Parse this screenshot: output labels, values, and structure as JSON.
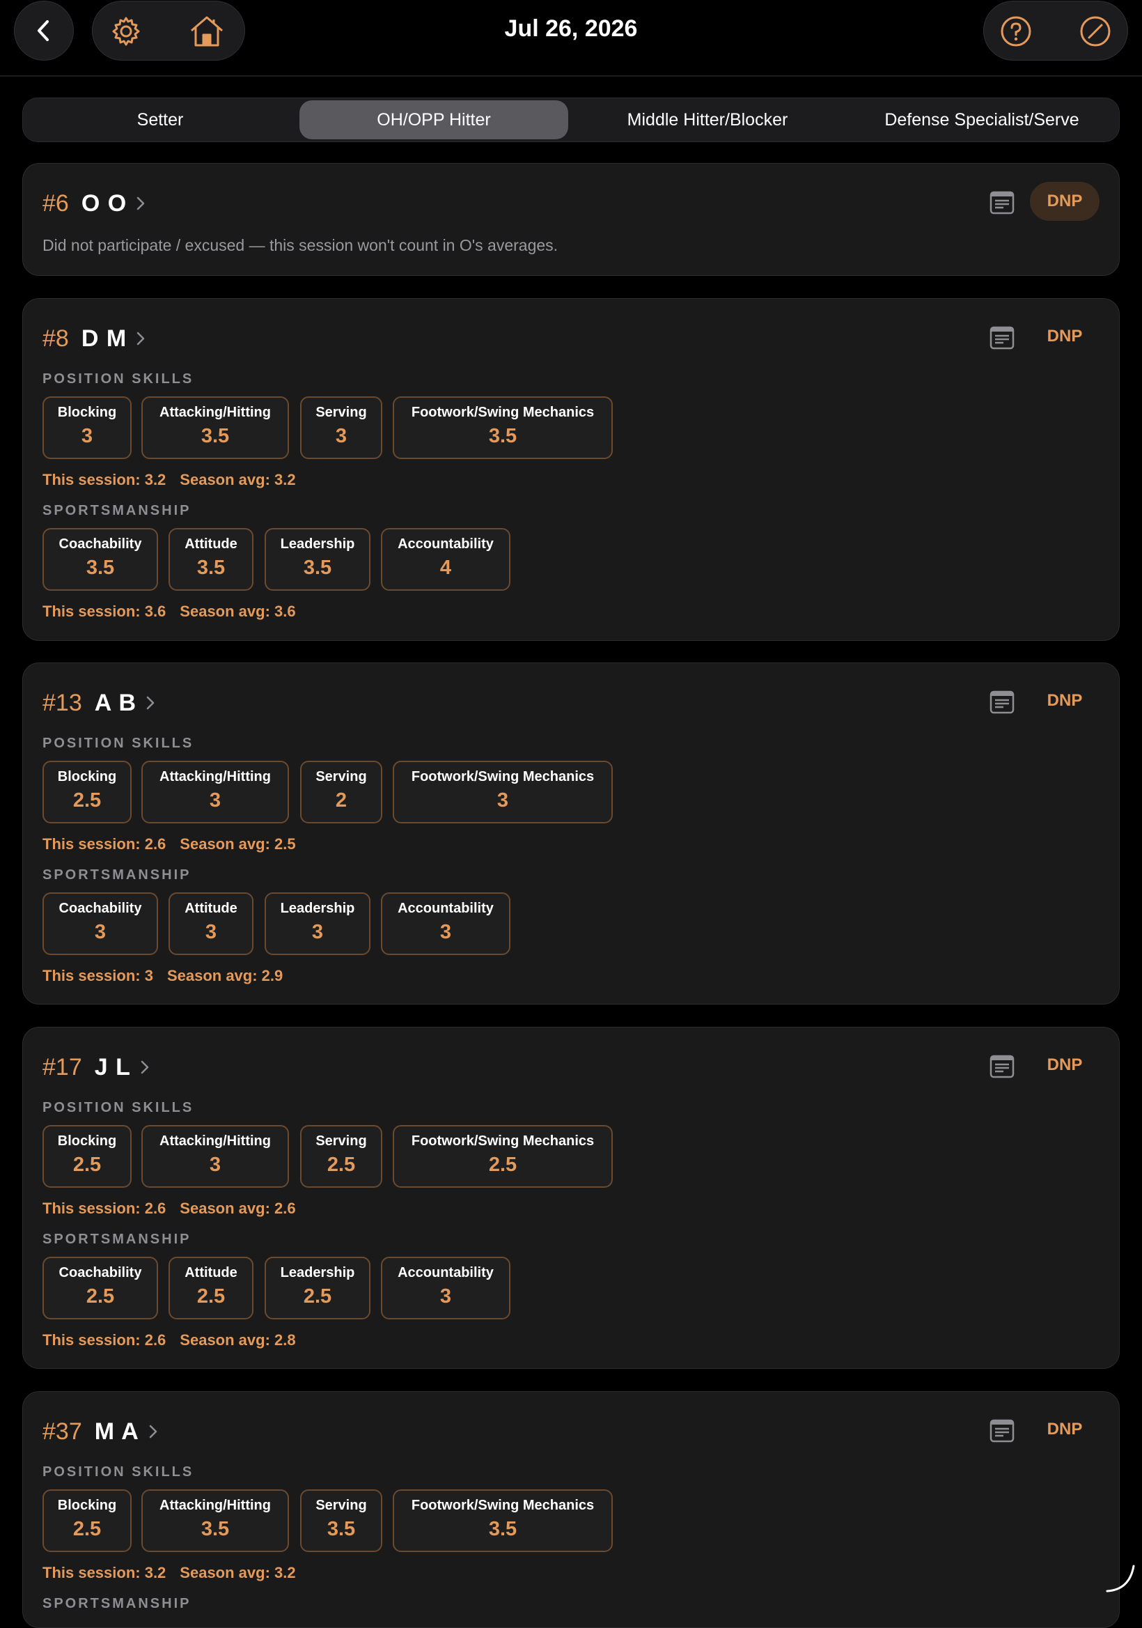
{
  "header": {
    "date": "Jul 26, 2026",
    "icons": [
      "back-chevron-icon",
      "gear-icon",
      "home-icon",
      "help-icon",
      "compass-icon"
    ],
    "accent": "#e39a5a"
  },
  "tabs": [
    {
      "label": "Setter",
      "active": false
    },
    {
      "label": "OH/OPP Hitter",
      "active": true
    },
    {
      "label": "Middle Hitter/Blocker",
      "active": false
    },
    {
      "label": "Defense Specialist/Serve",
      "active": false
    }
  ],
  "section_labels": {
    "position": "POSITION SKILLS",
    "sportsmanship": "SPORTSMANSHIP"
  },
  "dnp_label": "DNP",
  "players": [
    {
      "number": "#6",
      "name": "O O",
      "dnp": true,
      "dnp_message": "Did not participate / excused — this session won't count in O's averages."
    },
    {
      "number": "#8",
      "name": "D M",
      "dnp": false,
      "position_skills": [
        {
          "label": "Blocking",
          "value": "3"
        },
        {
          "label": "Attacking/Hitting",
          "value": "3.5"
        },
        {
          "label": "Serving",
          "value": "3"
        },
        {
          "label": "Footwork/Swing Mechanics",
          "value": "3.5"
        }
      ],
      "position_session": "This session: 3.2",
      "position_season": "Season avg: 3.2",
      "sportsmanship": [
        {
          "label": "Coachability",
          "value": "3.5"
        },
        {
          "label": "Attitude",
          "value": "3.5"
        },
        {
          "label": "Leadership",
          "value": "3.5"
        },
        {
          "label": "Accountability",
          "value": "4"
        }
      ],
      "sport_session": "This session: 3.6",
      "sport_season": "Season avg: 3.6"
    },
    {
      "number": "#13",
      "name": "A B",
      "dnp": false,
      "position_skills": [
        {
          "label": "Blocking",
          "value": "2.5"
        },
        {
          "label": "Attacking/Hitting",
          "value": "3"
        },
        {
          "label": "Serving",
          "value": "2"
        },
        {
          "label": "Footwork/Swing Mechanics",
          "value": "3"
        }
      ],
      "position_session": "This session: 2.6",
      "position_season": "Season avg: 2.5",
      "sportsmanship": [
        {
          "label": "Coachability",
          "value": "3"
        },
        {
          "label": "Attitude",
          "value": "3"
        },
        {
          "label": "Leadership",
          "value": "3"
        },
        {
          "label": "Accountability",
          "value": "3"
        }
      ],
      "sport_session": "This session: 3",
      "sport_season": "Season avg: 2.9"
    },
    {
      "number": "#17",
      "name": "J L",
      "dnp": false,
      "position_skills": [
        {
          "label": "Blocking",
          "value": "2.5"
        },
        {
          "label": "Attacking/Hitting",
          "value": "3"
        },
        {
          "label": "Serving",
          "value": "2.5"
        },
        {
          "label": "Footwork/Swing Mechanics",
          "value": "2.5"
        }
      ],
      "position_session": "This session: 2.6",
      "position_season": "Season avg: 2.6",
      "sportsmanship": [
        {
          "label": "Coachability",
          "value": "2.5"
        },
        {
          "label": "Attitude",
          "value": "2.5"
        },
        {
          "label": "Leadership",
          "value": "2.5"
        },
        {
          "label": "Accountability",
          "value": "3"
        }
      ],
      "sport_session": "This session: 2.6",
      "sport_season": "Season avg: 2.8"
    },
    {
      "number": "#37",
      "name": "M A",
      "dnp": false,
      "position_skills": [
        {
          "label": "Blocking",
          "value": "2.5"
        },
        {
          "label": "Attacking/Hitting",
          "value": "3.5"
        },
        {
          "label": "Serving",
          "value": "3.5"
        },
        {
          "label": "Footwork/Swing Mechanics",
          "value": "3.5"
        }
      ],
      "position_session": "This session: 3.2",
      "position_season": "Season avg: 3.2"
    }
  ]
}
